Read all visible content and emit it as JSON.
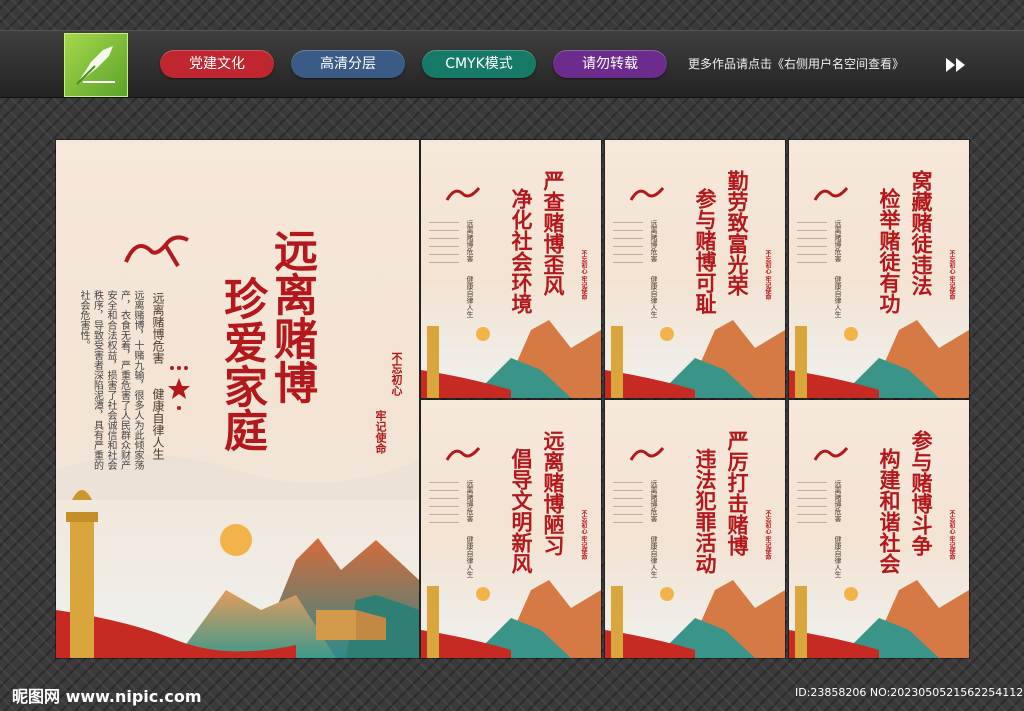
{
  "header": {
    "tags": [
      {
        "label": "党建文化",
        "color": "#c0262f"
      },
      {
        "label": "高清分层",
        "color": "#3a5b86"
      },
      {
        "label": "CMYK模式",
        "color": "#177a66"
      },
      {
        "label": "请勿转载",
        "color": "#6b2c8e"
      }
    ],
    "more_text": "更多作品请点击《右侧用户名空间查看》"
  },
  "main_poster": {
    "title_line1": "远离赌博",
    "title_line2": "珍爱家庭",
    "sub_left": "远离赌博危害",
    "sub_right": "健康自律人生",
    "seal_left": "不忘初心",
    "seal_right": "牢记使命",
    "paragraph": "远离赌博，十赌九输，很多人为此倾家荡产，衣食无着，严重危害了人民群众财产安全和合法权益，损害了社会诚信和社会秩序，导致受害者深陷泥潭，具有严重的社会危害性。"
  },
  "small_posters": [
    {
      "title1": "严查赌博歪风",
      "title2": "净化社会环境"
    },
    {
      "title1": "勤劳致富光荣",
      "title2": "参与赌博可耻"
    },
    {
      "title1": "窝藏赌徒违法",
      "title2": "检举赌徒有功"
    },
    {
      "title1": "远离赌博陋习",
      "title2": "倡导文明新风"
    },
    {
      "title1": "严厉打击赌博",
      "title2": "违法犯罪活动"
    },
    {
      "title1": "参与赌博斗争",
      "title2": "构建和谐社会"
    }
  ],
  "small_common": {
    "sub_left": "远离赌博危害",
    "sub_right": "健康自律人生",
    "seal": "不忘初心 牢记使命"
  },
  "footer": {
    "site": "昵图网 www.nipic.com",
    "id_text": "ID:23858206 NO:20230505215622541122"
  },
  "colors": {
    "title_red": "#b3181d",
    "poster_bg": "#f6e8da"
  }
}
